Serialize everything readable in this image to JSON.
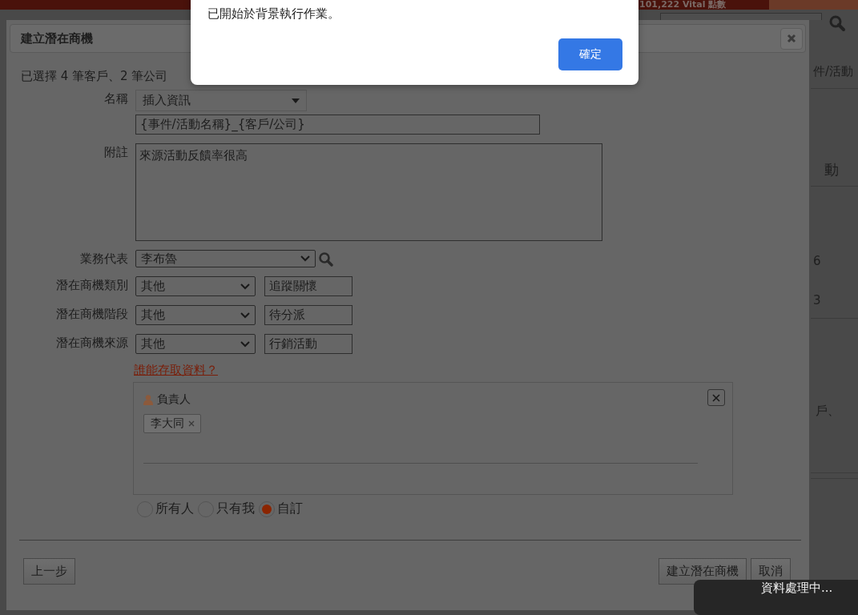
{
  "background_page": {
    "header_text": "101,222 Vital 點數",
    "fragments": [
      "件/活動",
      "動",
      "6",
      "3",
      "戶、"
    ]
  },
  "dialog": {
    "title": "建立潛在商機",
    "summary": "已選擇 4 筆客戶、2 筆公司",
    "fields": [
      {
        "kind": "dropdown",
        "label": "名稱",
        "value": "插入資訊"
      },
      {
        "kind": "text",
        "value": "{事件/活動名稱}_{客戶/公司}"
      },
      {
        "kind": "textarea",
        "label": "附註",
        "value": "來源活動反饋率很高"
      },
      {
        "kind": "select-search",
        "label": "業務代表",
        "value": "李布魯"
      },
      {
        "kind": "select-pair",
        "label": "潛在商機類別",
        "value": "其他",
        "extra": "追蹤關懷"
      },
      {
        "kind": "select-pair",
        "label": "潛在商機階段",
        "value": "其他",
        "extra": "待分派"
      },
      {
        "kind": "select-pair",
        "label": "潛在商機來源",
        "value": "其他",
        "extra": "行銷活動"
      }
    ],
    "access_link": "誰能存取資料？",
    "access_box": {
      "role": "負責人",
      "tags": [
        "李大同"
      ]
    },
    "access_options": [
      {
        "label": "所有人",
        "selected": false
      },
      {
        "label": "只有我",
        "selected": false
      },
      {
        "label": "自訂",
        "selected": true
      }
    ],
    "buttons": {
      "back": "上一步",
      "create": "建立潛在商機",
      "cancel": "取消"
    }
  },
  "alert": {
    "message": "已開始於背景執行作業。",
    "button": "確定"
  },
  "toast": {
    "message": "資料處理中..."
  }
}
